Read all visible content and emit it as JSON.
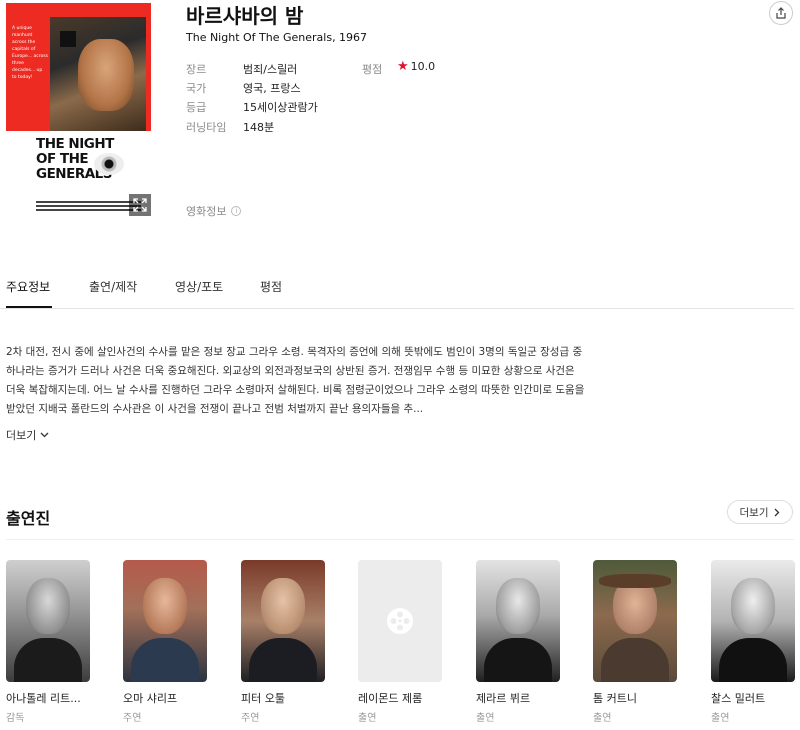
{
  "movie": {
    "title": "바르샤바의 밤",
    "subtitle": "The Night Of The Generals, 1967",
    "poster_title": "THE NIGHT OF THE GENERALS",
    "poster_blurb": "A unique manhunt across the capitals of Europe... across three decades... up to today!",
    "labels": {
      "genre": "장르",
      "country": "국가",
      "grade": "등급",
      "runtime": "러닝타임",
      "rating": "평점"
    },
    "values": {
      "genre": "범죄/스릴러",
      "country": "영국, 프랑스",
      "grade": "15세이상관람가",
      "runtime": "148분",
      "rating": "10.0"
    },
    "info_link": "영화정보"
  },
  "icons": {
    "share": "share-icon",
    "expand": "expand-icon",
    "star": "star-icon",
    "info": "info-icon",
    "chevron_down": "chevron-down-icon",
    "chevron_right": "chevron-right-icon",
    "film_reel": "film-reel-icon"
  },
  "colors": {
    "accent_red": "#e0132d",
    "poster_red": "#ee2b22"
  },
  "tabs": [
    {
      "label": "주요정보",
      "active": true
    },
    {
      "label": "출연/제작",
      "active": false
    },
    {
      "label": "영상/포토",
      "active": false
    },
    {
      "label": "평점",
      "active": false
    }
  ],
  "synopsis": "2차 대전, 전시 중에 살인사건의 수사를 맡은 정보 장교 그라우 소령. 목격자의 증언에 의해 뜻밖에도 범인이 3명의 독일군 장성급 중 하나라는 증거가 드러나 사건은 더욱 중요해진다. 외교상의 외전과정보국의 상반된 증거. 전쟁임무 수행 등 미묘한 상황으로 사건은 더욱 복잡해지는데. 어느 날 수사를 진행하던 그라우 소령마저 살해된다. 비록 점령군이었으나 그라우 소령의 따뜻한 인간미로 도움을 받았던 지배국 폴란드의 수사관은 이 사건을 전쟁이 끝나고 전범 처벌까지 끝난 용의자들을 추...",
  "more_label": "더보기",
  "cast": {
    "heading": "출연진",
    "more_label": "더보기",
    "members": [
      {
        "name": "아나톨레 리트...",
        "role": "감독"
      },
      {
        "name": "오마 샤리프",
        "role": "주연"
      },
      {
        "name": "피터 오툴",
        "role": "주연"
      },
      {
        "name": "레이몬드 제롬",
        "role": "출연"
      },
      {
        "name": "제라르 뷔르",
        "role": "출연"
      },
      {
        "name": "톰 커트니",
        "role": "출연"
      },
      {
        "name": "찰스 밀러트",
        "role": "출연"
      }
    ]
  }
}
